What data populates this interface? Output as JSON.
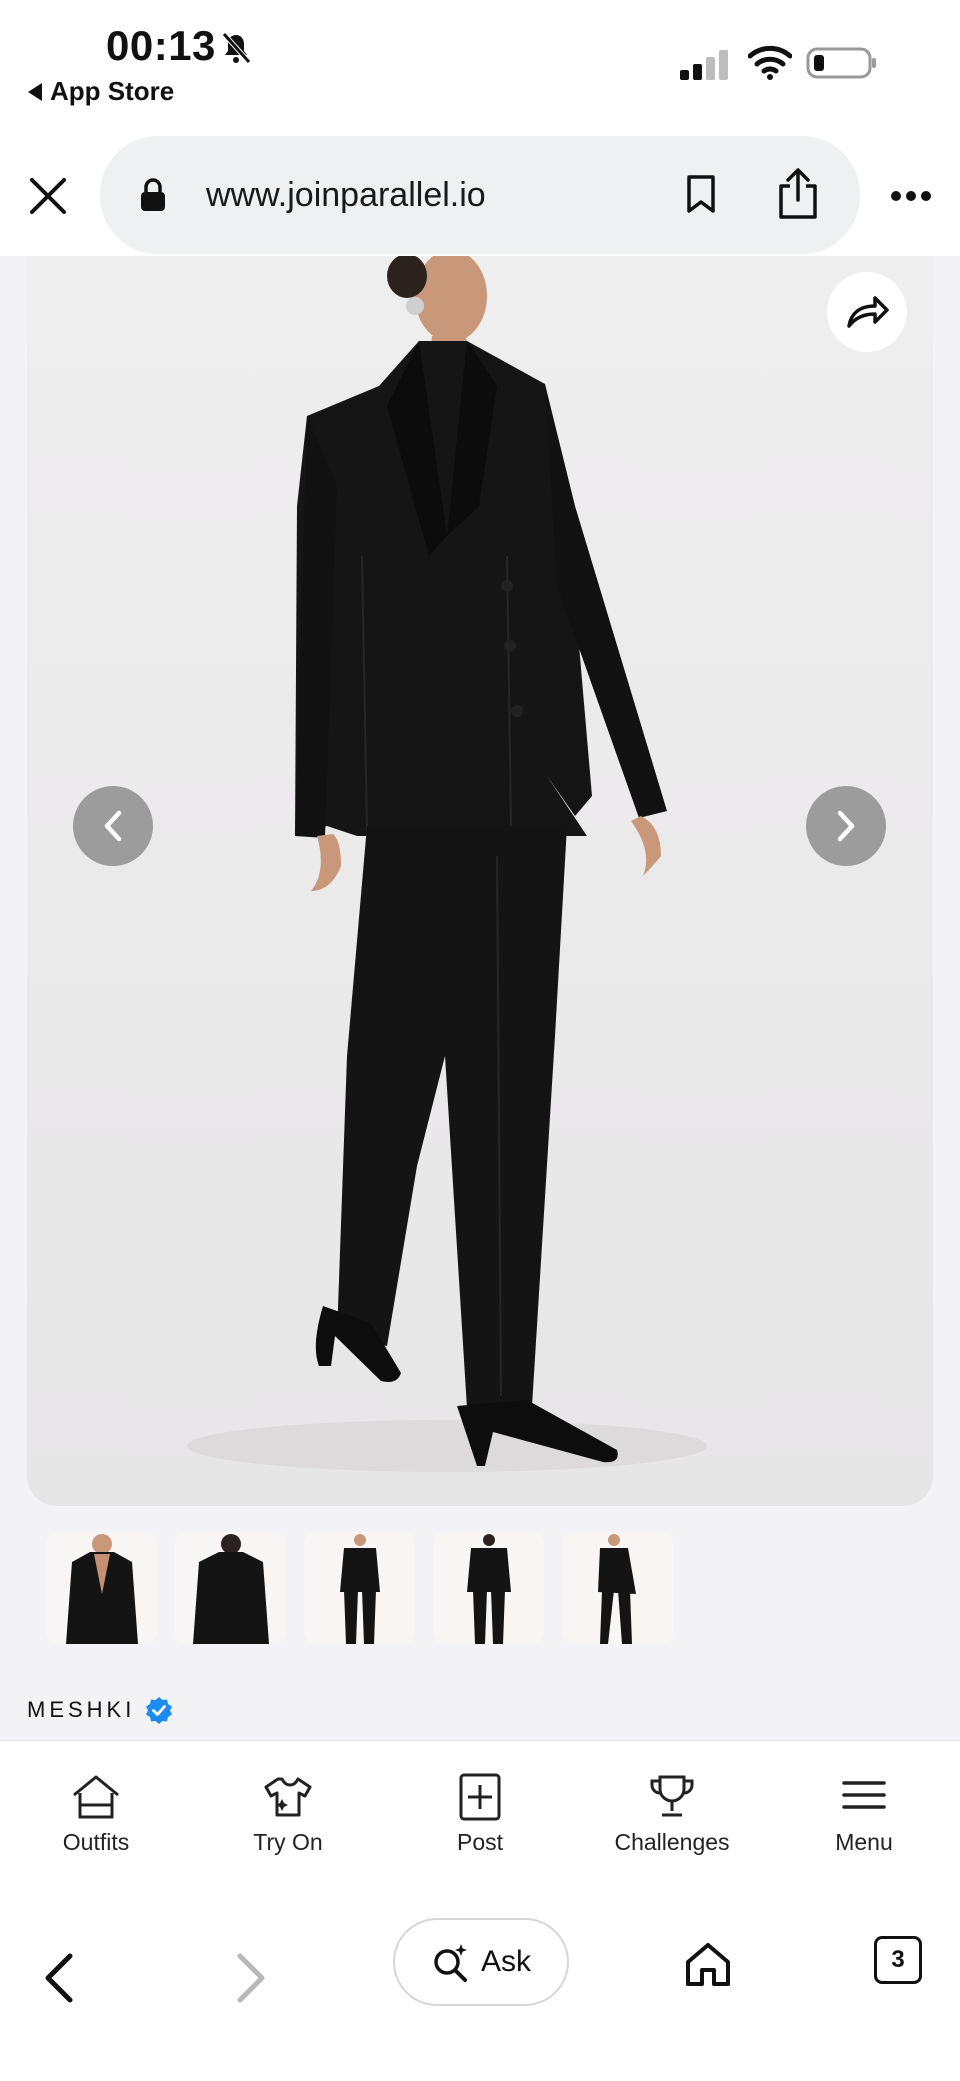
{
  "status_bar": {
    "time": "00:13",
    "back_to_app": "App Store"
  },
  "address_bar": {
    "url": "www.joinparallel.io"
  },
  "product": {
    "brand": "MESHKI",
    "thumbnail_count": 5
  },
  "app_tabs": [
    {
      "label": "Outfits",
      "icon": "home-icon"
    },
    {
      "label": "Try On",
      "icon": "shirt-sparkle-icon"
    },
    {
      "label": "Post",
      "icon": "plus-square-icon"
    },
    {
      "label": "Challenges",
      "icon": "trophy-icon"
    },
    {
      "label": "Menu",
      "icon": "hamburger-icon"
    }
  ],
  "browser_toolbar": {
    "ask_label": "Ask",
    "tab_count": "3"
  },
  "colors": {
    "verified": "#1d8cf0",
    "nav_circle": "#8a8a8a",
    "pill_bg": "#eef0f2"
  }
}
